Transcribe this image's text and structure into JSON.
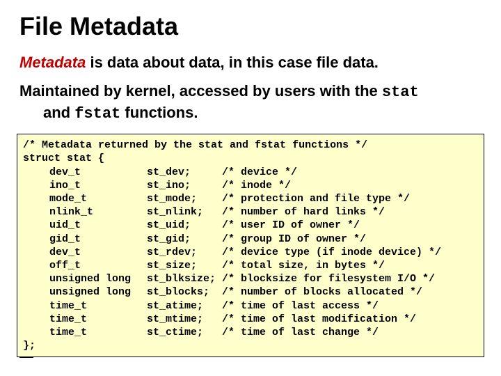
{
  "title": "File Metadata",
  "intro": {
    "keyword": "Metadata",
    "rest": " is data about data, in this case file data."
  },
  "subtext2": {
    "line1_pre": "Maintained by kernel, accessed by users with the ",
    "code1": "stat",
    "line2_pre": "and ",
    "code2": "fstat",
    "line2_post": " functions."
  },
  "code": {
    "comment_top": "/* Metadata returned by the stat and fstat functions */",
    "struct_open": "struct stat {",
    "struct_close": "};",
    "fields": [
      {
        "type": "dev_t",
        "name": "st_dev;",
        "comment": "/* device */"
      },
      {
        "type": "ino_t",
        "name": "st_ino;",
        "comment": "/* inode */"
      },
      {
        "type": "mode_t",
        "name": "st_mode;",
        "comment": "/* protection and file type */"
      },
      {
        "type": "nlink_t",
        "name": "st_nlink;",
        "comment": "/* number of hard links */"
      },
      {
        "type": "uid_t",
        "name": "st_uid;",
        "comment": "/* user ID of owner */"
      },
      {
        "type": "gid_t",
        "name": "st_gid;",
        "comment": "/* group ID of owner */"
      },
      {
        "type": "dev_t",
        "name": "st_rdev;",
        "comment": "/* device type (if inode device) */"
      },
      {
        "type": "off_t",
        "name": "st_size;",
        "comment": "/* total size, in bytes */"
      },
      {
        "type": "unsigned long",
        "name": "st_blksize;",
        "comment": "/* blocksize for filesystem I/O */"
      },
      {
        "type": "unsigned long",
        "name": "st_blocks;",
        "comment": "/* number of blocks allocated */"
      },
      {
        "type": "time_t",
        "name": "st_atime;",
        "comment": "/* time of last access */"
      },
      {
        "type": "time_t",
        "name": "st_mtime;",
        "comment": "/* time of last modification */"
      },
      {
        "type": "time_t",
        "name": "st_ctime;",
        "comment": "/* time of last change */"
      }
    ]
  }
}
